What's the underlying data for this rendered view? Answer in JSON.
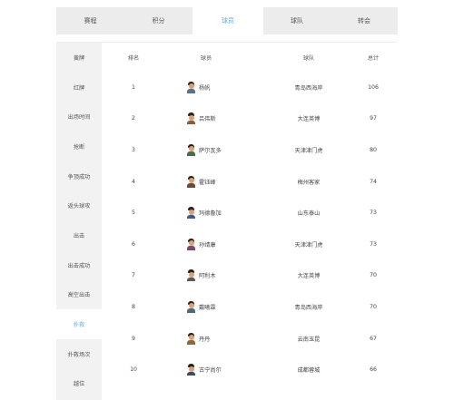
{
  "top_tabs": [
    {
      "label": "赛程"
    },
    {
      "label": "积分"
    },
    {
      "label": "球员"
    },
    {
      "label": "球队"
    },
    {
      "label": "转会"
    }
  ],
  "sidebar": {
    "items": [
      {
        "label": "黄牌"
      },
      {
        "label": "红牌"
      },
      {
        "label": "出场时间"
      },
      {
        "label": "抢断"
      },
      {
        "label": "争顶成功"
      },
      {
        "label": "返头球攻"
      },
      {
        "label": "出击"
      },
      {
        "label": "出击成功"
      },
      {
        "label": "高空出击"
      },
      {
        "label": "扑救"
      },
      {
        "label": "扑救场次"
      },
      {
        "label": "越位"
      }
    ],
    "active_index": 9
  },
  "table": {
    "headers": {
      "rank": "排名",
      "player": "球员",
      "team": "球队",
      "total": "总计"
    },
    "rows": [
      {
        "rank": "1",
        "player": "杨帆",
        "team": "青岛西海岸",
        "total": "106"
      },
      {
        "rank": "2",
        "player": "吕伟斯",
        "team": "大连英博",
        "total": "97"
      },
      {
        "rank": "3",
        "player": "萨尔瓦多",
        "team": "天津津门虎",
        "total": "80"
      },
      {
        "rank": "4",
        "player": "霍钰峰",
        "team": "梅州客家",
        "total": "74"
      },
      {
        "rank": "5",
        "player": "玛德魯加",
        "team": "山东泰山",
        "total": "73"
      },
      {
        "rank": "6",
        "player": "孙靖康",
        "team": "天津津门虎",
        "total": "73"
      },
      {
        "rank": "7",
        "player": "阿利木",
        "team": "大连英博",
        "total": "70"
      },
      {
        "rank": "8",
        "player": "戴曦霖",
        "team": "青岛西海岸",
        "total": "70"
      },
      {
        "rank": "9",
        "player": "丹丹",
        "team": "云南玉昆",
        "total": "67"
      },
      {
        "rank": "10",
        "player": "古宁尚尔",
        "team": "成都蓉城",
        "total": "66"
      }
    ]
  },
  "colors": {
    "accent": "#6aa8e0",
    "tab_bg": "#ececec",
    "sidebar_bg": "#f2f2f2"
  }
}
